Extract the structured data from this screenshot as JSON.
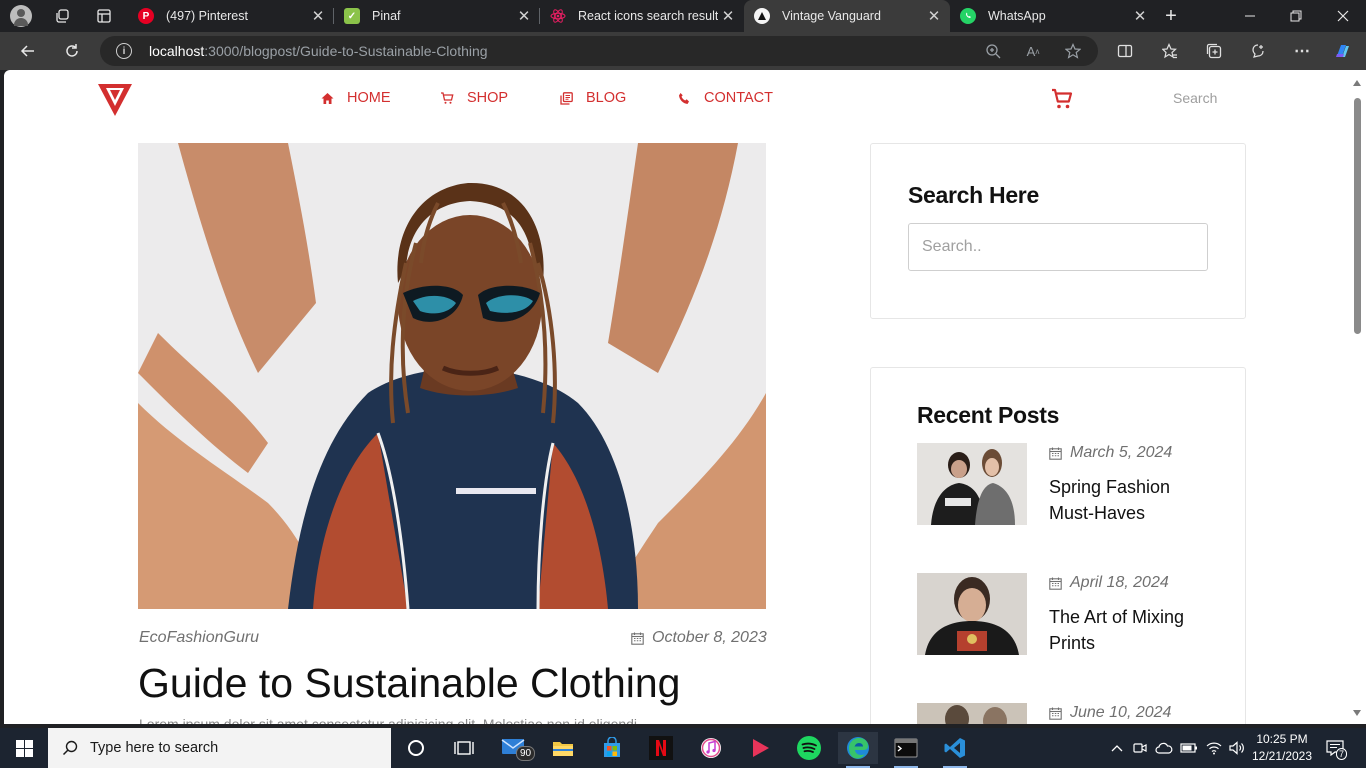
{
  "browser": {
    "tabs": [
      {
        "title": "(497) Pinterest",
        "favicon": "pinterest-icon",
        "color": "#e60023",
        "active": false
      },
      {
        "title": "Pinaf",
        "favicon": "pinaf-icon",
        "color": "#8bc34a",
        "active": false
      },
      {
        "title": "React icons search results",
        "favicon": "react-icon",
        "color": "#e91e63",
        "active": false
      },
      {
        "title": "Vintage Vanguard",
        "favicon": "vanguard-icon",
        "color": "#111111",
        "active": true
      },
      {
        "title": "WhatsApp",
        "favicon": "whatsapp-icon",
        "color": "#25d366",
        "active": false
      }
    ],
    "new_tab_label": "+",
    "url_host": "localhost",
    "url_rest": ":3000/blogpost/Guide-to-Sustainable-Clothing"
  },
  "site": {
    "brand_color": "#d32f2f",
    "nav": [
      {
        "label": "HOME",
        "icon": "home-icon"
      },
      {
        "label": "SHOP",
        "icon": "cart-icon"
      },
      {
        "label": "BLOG",
        "icon": "blog-icon"
      },
      {
        "label": "CONTACT",
        "icon": "phone-icon"
      }
    ],
    "search_label": "Search"
  },
  "post": {
    "author": "EcoFashionGuru",
    "date": "October 8, 2023",
    "title": "Guide to Sustainable Clothing",
    "excerpt": "Lorem ipsum dolor sit amet consectetur adipisicing elit. Molestiae non id eligendi"
  },
  "sidebar": {
    "search_heading": "Search Here",
    "search_placeholder": "Search..",
    "recent_heading": "Recent Posts",
    "recent": [
      {
        "date": "March 5, 2024",
        "title": "Spring Fashion Must-Haves"
      },
      {
        "date": "April 18, 2024",
        "title": "The Art of Mixing Prints"
      },
      {
        "date": "June 10, 2024",
        "title": ""
      }
    ]
  },
  "taskbar": {
    "search_placeholder": "Type here to search",
    "mail_badge": "90",
    "notification_count": "7",
    "time": "10:25 PM",
    "date": "12/21/2023"
  }
}
